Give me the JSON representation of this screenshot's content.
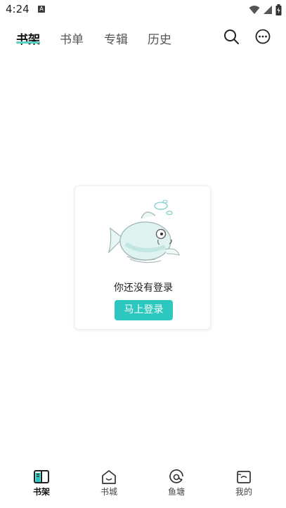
{
  "status_bar": {
    "time": "4:24",
    "notification_letter": "A"
  },
  "top_tabs": [
    {
      "label": "书架",
      "active": true
    },
    {
      "label": "书单",
      "active": false
    },
    {
      "label": "专辑",
      "active": false
    },
    {
      "label": "历史",
      "active": false
    }
  ],
  "header_icons": [
    "search-icon",
    "more-icon"
  ],
  "empty_state": {
    "message": "你还没有登录",
    "button_label": "马上登录",
    "illustration": "fish-illustration"
  },
  "bottom_nav": [
    {
      "label": "书架",
      "icon": "bookshelf-icon",
      "active": true
    },
    {
      "label": "书城",
      "icon": "bookstore-icon",
      "active": false
    },
    {
      "label": "鱼塘",
      "icon": "fish-pond-icon",
      "active": false
    },
    {
      "label": "我的",
      "icon": "profile-icon",
      "active": false
    }
  ],
  "colors": {
    "accent": "#2cc8bf",
    "accent_light": "#58d1c5",
    "text": "#222222"
  }
}
